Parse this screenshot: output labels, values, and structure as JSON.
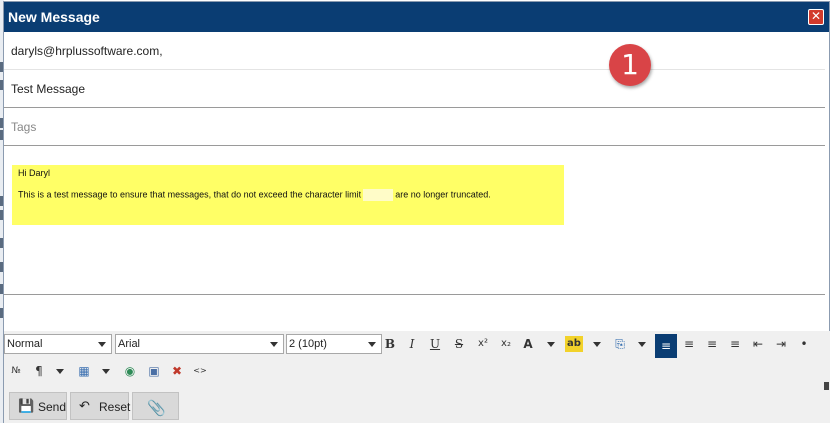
{
  "dialog": {
    "title": "New Message",
    "close_icon": "✕"
  },
  "compose": {
    "to": "daryls@hrplussoftware.com,",
    "subject": "Test Message",
    "tags_placeholder": "Tags"
  },
  "annotation": {
    "number": "1"
  },
  "message": {
    "line1": "Hi Daryl",
    "line2_before": "This is a test message to ensure that messages, that do not exceed the character limit",
    "line2_after": "are no longer truncated."
  },
  "toolbar": {
    "format": "Normal",
    "font": "Arial",
    "size": "2 (10pt)",
    "bold": "B",
    "italic": "I",
    "underline": "U",
    "strike": "S",
    "superscript": "x²",
    "subscript": "x₂",
    "font_color": "A",
    "highlight": "ab",
    "paste": "⎘",
    "align_left": "≡",
    "align_center": "≡",
    "align_right": "≡",
    "justify": "≡",
    "outdent": "⇤",
    "indent": "⇥",
    "bullets": "•",
    "numbered": "№",
    "paragraph": "¶",
    "table": "▦",
    "link": "◉",
    "image": "▣",
    "delete": "✖",
    "source": "<>"
  },
  "actions": {
    "send_label": "Send",
    "send_icon": "💾",
    "reset_label": "Reset",
    "reset_icon": "↶",
    "attach_icon": "📎"
  },
  "colors": {
    "titlebar": "#0a3d73",
    "highlight": "#ffff66",
    "close": "#d23a2c",
    "badge": "#d94447"
  }
}
